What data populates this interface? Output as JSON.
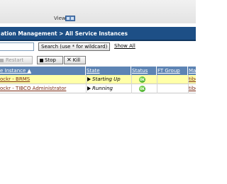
{
  "top": {
    "view_label": "View:"
  },
  "title": "ation Management > All Service Instances",
  "search": {
    "value": "",
    "button_label": "Search (use * for wildcard)",
    "show_all_label": "Show All"
  },
  "toolbar": {
    "restart_label": "Restart",
    "stop_label": "Stop",
    "kill_label": "Kill"
  },
  "table": {
    "columns": [
      "e Instance ▲",
      "State",
      "Status",
      "FT Group",
      "Ma"
    ],
    "rows": [
      {
        "instance": "ockr - BRMS",
        "state": "Starting Up",
        "status": "OK",
        "ft_group": "",
        "machine": "tibc",
        "highlight": true
      },
      {
        "instance": "ockr - TIBCO Administrator",
        "state": "Running",
        "status": "OK",
        "ft_group": "",
        "machine": "tibc",
        "highlight": false
      }
    ]
  },
  "colors": {
    "title_bar": "#1d4f86",
    "header": "#5d84b4",
    "highlight_row": "#ffffa8",
    "status_ok": "#3aa821"
  }
}
